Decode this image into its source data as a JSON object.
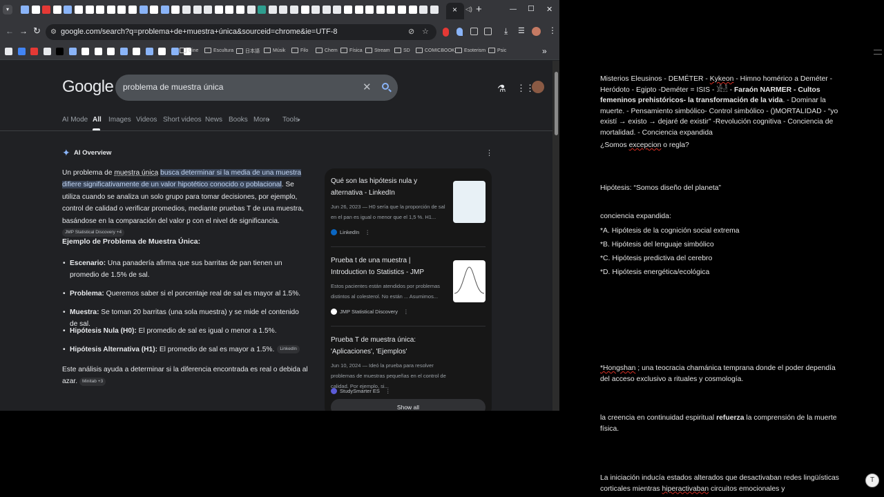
{
  "browser": {
    "tab_close": "×",
    "new_tab": "+",
    "window_controls": {
      "minimize": "—",
      "maximize": "☐",
      "close": "✕"
    },
    "address_url": "google.com/search?q=problema+de+muestra+única&sourceid=chrome&ie=UTF-8",
    "bookmarks": [
      "Cine",
      "Escultura",
      "日本語",
      "Músik",
      "Filo",
      "Chem",
      "Física",
      "Stream",
      "SD",
      "COMICBOOK",
      "Esoterism",
      "Psic"
    ],
    "bookmarks_overflow": "»"
  },
  "google": {
    "logo": "Google",
    "query": "problema de muestra única",
    "tabs": [
      "AI Mode",
      "All",
      "Images",
      "Videos",
      "Short videos",
      "News",
      "Books",
      "More",
      "Tools"
    ],
    "active_tab": "All"
  },
  "ai_overview": {
    "label": "AI Overview",
    "intro_pre": "Un problema de ",
    "intro_link": "muestra única",
    "intro_highlight": "busca determinar si la media de una muestra difiere significativamente de un valor hipotético conocido o poblacional",
    "intro_post": ". Se utiliza cuando se analiza un solo grupo para tomar decisiones, por ejemplo, control de calidad o verificar promedios, mediante pruebas T de una muestra, basándose en la comparación del valor p con el nivel de significancia.",
    "intro_chip": "JMP Statistical Discovery +4",
    "example_heading": "Ejemplo de Problema de Muestra Única:",
    "bullets": [
      {
        "label": "Escenario:",
        "text": " Una panadería afirma que sus barritas de pan tienen un promedio de 1.5% de sal."
      },
      {
        "label": "Problema:",
        "text": " Queremos saber si el porcentaje real de sal es mayor al 1.5%."
      },
      {
        "label": "Muestra:",
        "text": " Se toman 20 barritas (una sola muestra) y se mide el contenido de sal."
      },
      {
        "label": "Hipótesis Nula (H0):",
        "text": " El promedio de sal es igual o menor a 1.5%."
      },
      {
        "label": "Hipótesis Alternativa (H1):",
        "text": " El promedio de sal es mayor a 1.5%."
      }
    ],
    "bullet5_chip": "LinkedIn",
    "conclusion": "Este análisis ayuda a determinar si la diferencia encontrada es real o debida al azar.",
    "conclusion_chip": "Minitab +3"
  },
  "sources": [
    {
      "title": "Qué son las hipótesis nula y alternativa - LinkedIn",
      "snippet": "Jun 26, 2023 — H0 sería que la proporción de sal en el pan es igual o menor que el 1,5 %. H1...",
      "site": "LinkedIn"
    },
    {
      "title": "Prueba t de una muestra | Introduction to Statistics - JMP",
      "snippet": "Estos pacientes están atendidos por problemas distintos al colesterol. No están ... Asumimos...",
      "site": "JMP Statistical Discovery"
    },
    {
      "title": "Prueba T de muestra única: 'Aplicaciones', 'Ejemplos'",
      "snippet": "Jun 10, 2024 — Ideó la prueba para resolver problemas de muestras pequeñas en el control de calidad. Por ejemplo, si...",
      "site": "StudySmarter ES"
    }
  ],
  "show_all": "Show all",
  "doc": {
    "p1_a": "Misterios Eleusinos - DEMÉTER - ",
    "p1_kykeon": "Kykeon",
    "p1_b": "  - Himno homérico a Deméter - Heródoto - Egipto -Deméter = ISIS - 𓀀𓁐 - ",
    "p1_bold": "Faraón NARMER - Cultos femeninos prehistóricos- la transformación de la vida",
    "p1_c": ". - Dominar la muerte. - Pensamiento simbólico- Control simbólico - ()MORTALIDAD - “yo existí → existo → dejaré de existir” -Revolución cognitiva - Conciencia de mortalidad. - Conciencia expandida",
    "p2_a": "¿Somos ",
    "p2_sq": "excepcion",
    "p2_b": " o regla?",
    "p3": "Hipótesis:  “Somos diseño del planeta”",
    "p4": "conciencia expandida:",
    "list": [
      "*A. Hipótesis de la cognición social extrema",
      "*B. Hipótesis del lenguaje simbólico",
      "*C. Hipótesis predictiva del cerebro",
      "*D. Hipótesis energética/ecológica"
    ],
    "p5_sq": "*Hongshan",
    "p5": " ; una teocracia chamánica temprana donde el poder dependía del acceso exclusivo a rituales y cosmología.",
    "p6_a": "la creencia en continuidad espiritual ",
    "p6_bold": "refuerza",
    "p6_b": " la comprensión de la muerte física.",
    "p7_a": "La iniciación inducía estados alterados que desactivaban redes lingüísticas corticales mientras ",
    "p7_sq": "hiperactivaban",
    "p7_b": " circuitos emocionales y"
  },
  "colors": {
    "accent_blue": "#8ab4f8",
    "highlight": "#394457",
    "page_bg": "#202124",
    "chrome_bg": "#35363a"
  }
}
